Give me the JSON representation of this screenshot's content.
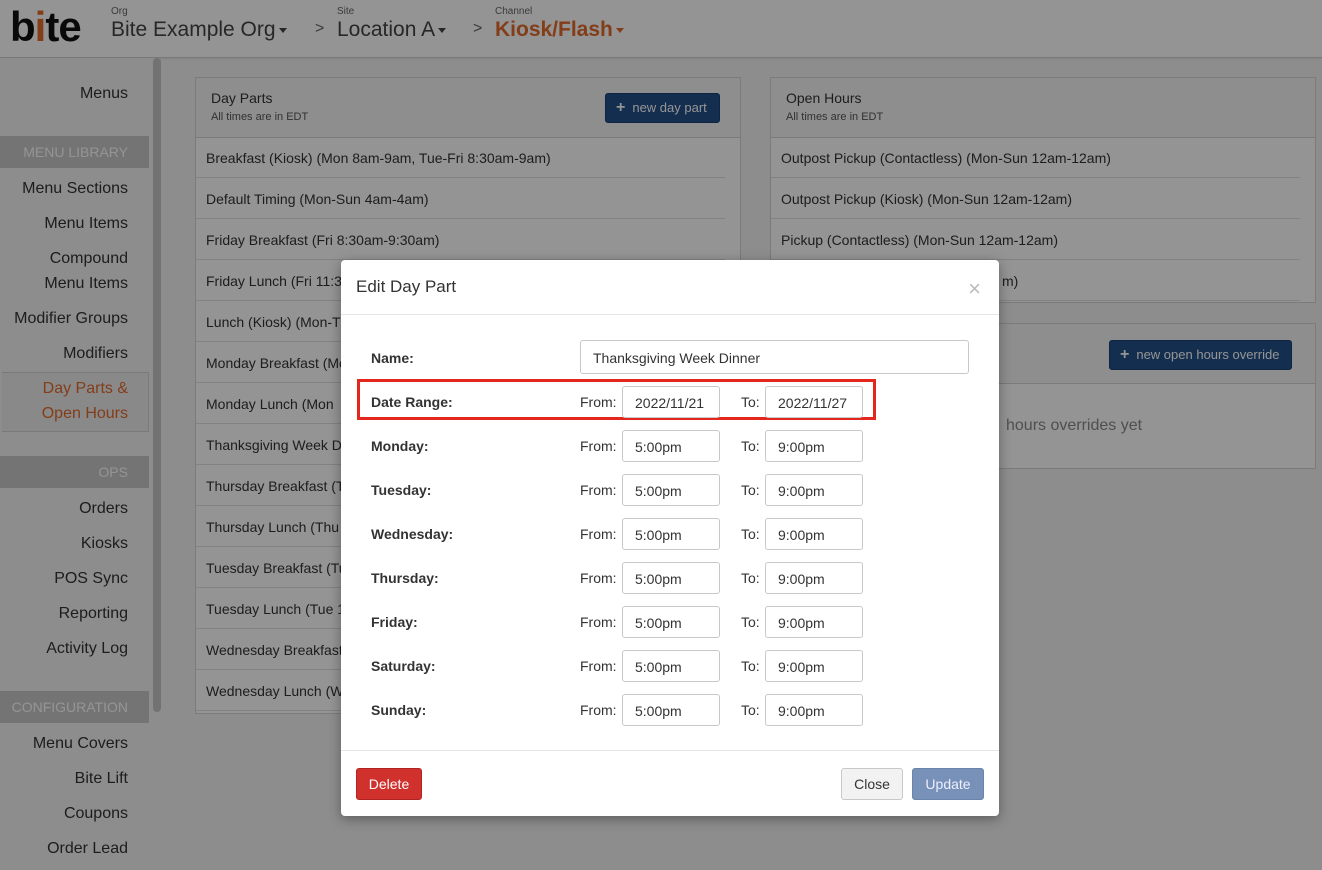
{
  "header": {
    "logo": {
      "before": "b",
      "dot": "i",
      "after": "te"
    },
    "org": {
      "caption": "Org",
      "value": "Bite Example Org"
    },
    "site": {
      "caption": "Site",
      "value": "Location A"
    },
    "channel": {
      "caption": "Channel",
      "value": "Kiosk/Flash"
    },
    "separator": ">"
  },
  "sidebar": {
    "top_item": "Menus",
    "sections": [
      {
        "title": "MENU LIBRARY"
      },
      {
        "title": "OPS"
      },
      {
        "title": "CONFIGURATION"
      }
    ],
    "menu_library_items": [
      "Menu Sections",
      "Menu Items",
      "Compound",
      "Menu Items",
      "Modifier Groups",
      "Modifiers",
      "Day Parts &",
      "Open Hours"
    ],
    "ops_items": [
      "Orders",
      "Kiosks",
      "POS Sync",
      "Reporting",
      "Activity Log"
    ],
    "configuration_items": [
      "Menu Covers",
      "Bite Lift",
      "Coupons",
      "Order Lead"
    ]
  },
  "day_parts_panel": {
    "title": "Day Parts",
    "subtitle": "All times are in EDT",
    "new_button": "new day part",
    "rows": [
      "Breakfast (Kiosk) (Mon 8am-9am, Tue-Fri 8:30am-9am)",
      "Default Timing (Mon-Sun 4am-4am)",
      "Friday Breakfast (Fri 8:30am-9:30am)",
      "Friday Lunch (Fri 11:3",
      "Lunch (Kiosk) (Mon-Tu",
      "Monday Breakfast (Mo",
      "Monday Lunch (Mon",
      "Thanksgiving Week D",
      "Thursday Breakfast (T",
      "Thursday Lunch (Thu",
      "Tuesday Breakfast (Tu",
      "Tuesday Lunch (Tue 1",
      "Wednesday Breakfast",
      "Wednesday Lunch (W"
    ]
  },
  "open_hours_panel": {
    "title": "Open Hours",
    "subtitle": "All times are in EDT",
    "rows": [
      "Outpost Pickup (Contactless) (Mon-Sun 12am-12am)",
      "Outpost Pickup (Kiosk) (Mon-Sun 12am-12am)",
      "Pickup (Contactless) (Mon-Sun 12am-12am)",
      "m)"
    ]
  },
  "overrides_panel": {
    "new_button": "new open hours override",
    "empty_text": "hours overrides yet"
  },
  "modal": {
    "title": "Edit Day Part",
    "close_glyph": "×",
    "name_label": "Name:",
    "name_value": "Thanksgiving Week Dinner",
    "from_label": "From:",
    "to_label": "To:",
    "rows": [
      {
        "label": "Date Range:",
        "from": "2022/11/21",
        "to": "2022/11/27"
      },
      {
        "label": "Monday:",
        "from": "5:00pm",
        "to": "9:00pm"
      },
      {
        "label": "Tuesday:",
        "from": "5:00pm",
        "to": "9:00pm"
      },
      {
        "label": "Wednesday:",
        "from": "5:00pm",
        "to": "9:00pm"
      },
      {
        "label": "Thursday:",
        "from": "5:00pm",
        "to": "9:00pm"
      },
      {
        "label": "Friday:",
        "from": "5:00pm",
        "to": "9:00pm"
      },
      {
        "label": "Saturday:",
        "from": "5:00pm",
        "to": "9:00pm"
      },
      {
        "label": "Sunday:",
        "from": "5:00pm",
        "to": "9:00pm"
      }
    ],
    "delete_button": "Delete",
    "close_button": "Close",
    "update_button": "Update"
  },
  "colors": {
    "accent": "#e26a2c",
    "primary_button": "#24508a",
    "delete_button": "#d0312d",
    "highlight": "#e4271c"
  }
}
